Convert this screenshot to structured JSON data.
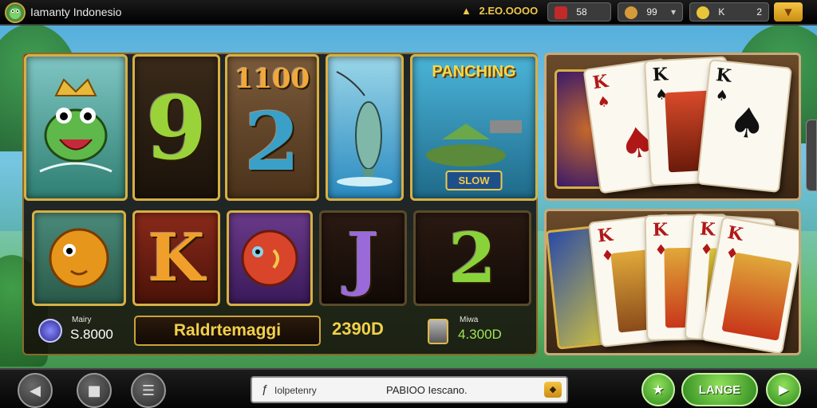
{
  "header": {
    "title": "Iamanty Indonesio",
    "jackpot": "2.EO.OOOO",
    "counter_1": "58",
    "counter_2": "99",
    "counter_3_label": "K",
    "counter_3_value": "2"
  },
  "reels": {
    "row1": [
      {
        "icon": "frog-icon"
      },
      {
        "glyph": "9"
      },
      {
        "number": "1100",
        "glyph": "2"
      },
      {
        "icon": "fishing-fish-icon"
      },
      {
        "label": "PANCHING",
        "button": "SLOW"
      }
    ],
    "row2": [
      {
        "icon": "goldfish-icon"
      },
      {
        "glyph": "K"
      },
      {
        "icon": "fish-coin-icon"
      },
      {
        "glyph": "J"
      },
      {
        "glyph": "2"
      }
    ]
  },
  "footer": {
    "left_label": "Mairy",
    "left_value": "S.8000",
    "name_plate": "Raldrtemaggi",
    "center_value": "2390D",
    "right_label": "Miwa",
    "right_value": "4.300D"
  },
  "cards_top": [
    {
      "rank": "K",
      "suit": "♠",
      "color": "#b01818"
    },
    {
      "rank": "K",
      "suit": "♠",
      "color": "#111111"
    },
    {
      "rank": "K",
      "suit": "♠",
      "color": "#111111"
    }
  ],
  "cards_bottom": [
    {
      "rank": "K",
      "suit": "♦",
      "color": "#b01818"
    },
    {
      "rank": "K",
      "suit": "♦",
      "color": "#b01818"
    },
    {
      "rank": "K",
      "suit": "♦",
      "color": "#b01818"
    },
    {
      "rank": "K",
      "suit": "♦",
      "color": "#b01818"
    }
  ],
  "bottom": {
    "search_placeholder": "Iolpetenry",
    "search_value": "PABIOO Iescano.",
    "action_label": "LANGE"
  },
  "colors": {
    "gold": "#d7b043",
    "green": "#2f8a1e"
  }
}
